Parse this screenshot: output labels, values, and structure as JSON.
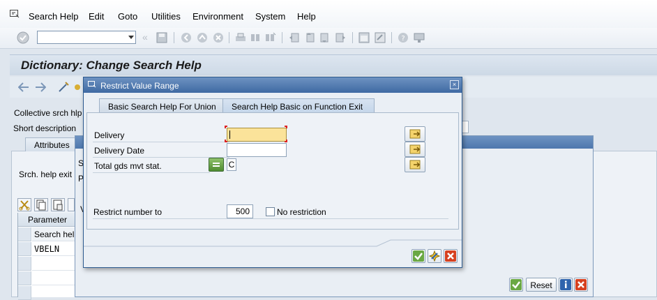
{
  "menu": {
    "items": [
      {
        "label": "Search Help"
      },
      {
        "label": "Edit"
      },
      {
        "label": "Goto"
      },
      {
        "label": "Utilities"
      },
      {
        "label": "Environment"
      },
      {
        "label": "System"
      },
      {
        "label": "Help"
      }
    ]
  },
  "toolbar": {
    "command_field_value": "",
    "icons": [
      "enter-icon",
      "back-icon",
      "save-icon",
      "back-nav-icon",
      "exit-icon",
      "cancel-icon",
      "print-icon",
      "find-icon",
      "find-next-icon",
      "first-page-icon",
      "prev-page-icon",
      "next-page-icon",
      "last-page-icon",
      "new-session-icon",
      "shortcut-icon",
      "help-icon",
      "layout-icon"
    ]
  },
  "page": {
    "title": "Dictionary: Change Search Help"
  },
  "background": {
    "collective_label": "Collective srch hlp",
    "short_desc_label": "Short description",
    "attributes_tab": "Attributes",
    "srch_help_exit_label": "Srch. help exit",
    "parameter_header": "Parameter",
    "search_help_header": "Search help",
    "row_value": "VBELN",
    "fragment_s": "S",
    "fragment_p": "P",
    "fragment_v": "V",
    "reset_label": "Reset"
  },
  "dialog": {
    "title": "Restrict Value Range",
    "tabs": [
      {
        "label": "Basic Search Help For Union"
      },
      {
        "label": "Search Help Basic on Function Exit"
      }
    ],
    "fields": {
      "delivery_label": "Delivery",
      "delivery_value": "",
      "delivery_date_label": "Delivery Date",
      "delivery_date_value": "",
      "total_gds_label": "Total gds mvt stat.",
      "total_gds_value": "C",
      "restrict_label": "Restrict number to",
      "restrict_value": "500",
      "no_restriction_label": "No restriction",
      "no_restriction_checked": false
    }
  }
}
